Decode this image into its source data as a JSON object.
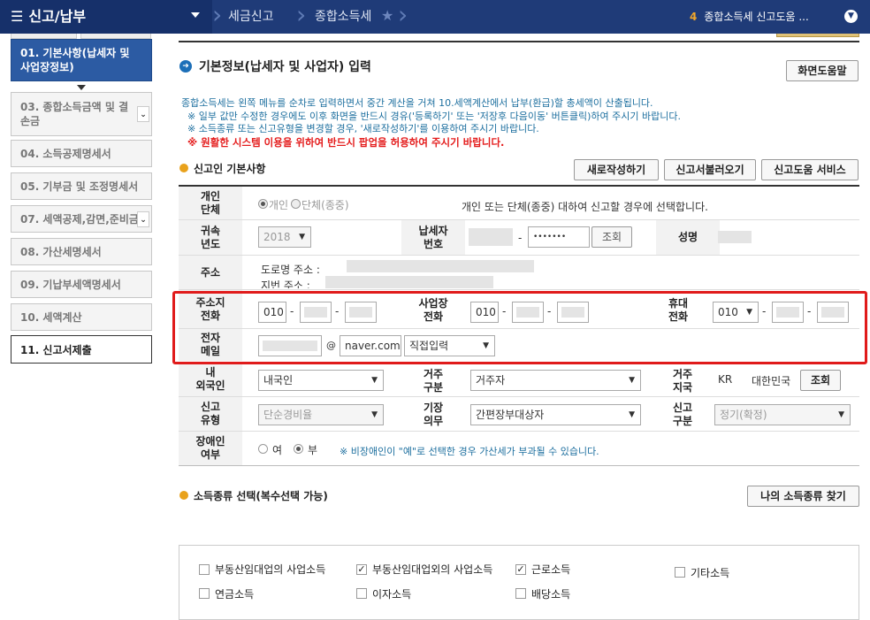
{
  "topbar": {
    "menu_title": "신고/납부",
    "breadcrumbs": [
      "세금신고",
      "종합소득세"
    ],
    "notice_count": "4",
    "notice_text": "종합소득세 신고도움 ..."
  },
  "sidebar": {
    "items": [
      {
        "label": "01. 기본사항(납세자 및 사업장정보)",
        "state": "active"
      },
      {
        "label": "03. 종합소득금액 및 결손금",
        "state": "normal",
        "has_dropdown": true
      },
      {
        "label": "04. 소득공제명세서",
        "state": "normal"
      },
      {
        "label": "05. 기부금 및 조정명세서",
        "state": "normal"
      },
      {
        "label": "07. 세액공제,감면,준비금",
        "state": "normal",
        "has_dropdown": true
      },
      {
        "label": "08. 가산세명세서",
        "state": "normal"
      },
      {
        "label": "09. 기납부세액명세서",
        "state": "normal"
      },
      {
        "label": "10. 세액계산",
        "state": "normal"
      },
      {
        "label": "11. 신고서제출",
        "state": "selected"
      }
    ]
  },
  "main": {
    "section_title": "기본정보(납세자 및 사업자) 입력",
    "help_button": "화면도움말",
    "info_lines": [
      "종합소득세는 왼쪽 메뉴를 순차로 입력하면서 중간 계산을 거쳐 10.세액계산에서 납부(환급)할 총세액이 산출됩니다.",
      "※ 일부 값만 수정한 경우에도 이후 화면을 반드시 경유('등록하기' 또는 '저장후 다음이동' 버튼클릭)하여 주시기 바랍니다.",
      "※ 소득종류 또는 신고유형을 변경할 경우, '새로작성하기'를 이용하여 주시기 바랍니다."
    ],
    "warning": "※ 원활한 시스템 이용을 위하여 반드시 팝업을 허용하여 주시기 바랍니다.",
    "basic_section": "신고인 기본사항",
    "buttons": {
      "new": "새로작성하기",
      "load": "신고서불러오기",
      "help_service": "신고도움 서비스"
    }
  },
  "form": {
    "type_label": "개인\n단체",
    "type_options": [
      "개인",
      "단체(종중)"
    ],
    "type_note": "개인 또는 단체(종중) 대하여 신고할 경우에 선택합니다.",
    "year_label": "귀속\n년도",
    "year_value": "2018",
    "taxid_label": "납세자\n번호",
    "taxid_masked": "•••••••",
    "lookup": "조회",
    "name_label": "성명",
    "address_label": "주소",
    "road_address_label": "도로명 주소 :",
    "lot_address_label": "지번 주소 :",
    "home_phone_label": "주소지\n전화",
    "home_phone_prefix": "010",
    "biz_phone_label": "사업장\n전화",
    "biz_phone_prefix": "010",
    "mobile_label": "휴대\n전화",
    "mobile_prefix": "010",
    "email_label": "전자\n메일",
    "email_at": "@",
    "email_domain": "naver.com",
    "email_domain_select": "직접입력",
    "nationality_label": "내\n외국인",
    "nationality_value": "내국인",
    "residence_label": "거주\n구분",
    "residence_value": "거주자",
    "country_label": "거주\n지국",
    "country_code": "KR",
    "country_name": "대한민국",
    "filing_type_label": "신고\n유형",
    "filing_type_value": "단순경비율",
    "bookkeeping_label": "기장\n의무",
    "bookkeeping_value": "간편장부대상자",
    "filing_class_label": "신고\n구분",
    "filing_class_value": "정기(확정)",
    "disability_label": "장애인\n여부",
    "disability_options": [
      "여",
      "부"
    ],
    "disability_note": "※ 비장애인이 \"예\"로 선택한 경우 가산세가 부과될 수 있습니다."
  },
  "income": {
    "section_title": "소득종류 선택(복수선택 가능)",
    "find_button": "나의 소득종류 찾기",
    "types": [
      {
        "label": "부동산임대업의 사업소득",
        "checked": false
      },
      {
        "label": "부동산임대업외의 사업소득",
        "checked": true
      },
      {
        "label": "근로소득",
        "checked": true
      },
      {
        "label": "기타소득",
        "checked": false
      },
      {
        "label": "연금소득",
        "checked": false
      },
      {
        "label": "이자소득",
        "checked": false
      },
      {
        "label": "배당소득",
        "checked": false
      }
    ]
  }
}
